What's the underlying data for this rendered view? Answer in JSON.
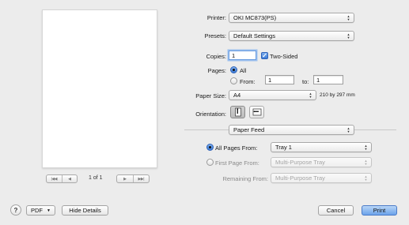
{
  "printer": {
    "label": "Printer:",
    "value": "OKI MC873(PS)"
  },
  "presets": {
    "label": "Presets:",
    "value": "Default Settings"
  },
  "copies": {
    "label": "Copies:",
    "value": "1",
    "two_sided_label": "Two-Sided",
    "two_sided_checked": true
  },
  "pages": {
    "label": "Pages:",
    "all_label": "All",
    "from_label": "From:",
    "from_value": "1",
    "to_label": "to:",
    "to_value": "1",
    "selected": "All"
  },
  "paper_size": {
    "label": "Paper Size:",
    "value": "A4",
    "dimensions": "210 by 297 mm"
  },
  "orientation": {
    "label": "Orientation:",
    "selected": "portrait"
  },
  "section_popup": {
    "value": "Paper Feed"
  },
  "paper_feed": {
    "all_pages_label": "All Pages From:",
    "all_pages_value": "Tray 1",
    "first_page_label": "First Page From:",
    "first_page_value": "Multi-Purpose Tray",
    "remaining_label": "Remaining From:",
    "remaining_value": "Multi-Purpose Tray",
    "selected": "all_pages"
  },
  "preview_nav": {
    "first": "|◀◀",
    "prev": "◀",
    "next": "▶",
    "last": "▶▶|",
    "page_count": "1 of 1"
  },
  "footer": {
    "help": "?",
    "pdf_label": "PDF",
    "hide_details": "Hide Details",
    "cancel": "Cancel",
    "print": "Print"
  },
  "colors": {
    "accent": "#3b7ad6",
    "background": "#ececec"
  },
  "icons": [
    "help-icon",
    "checkmark-icon",
    "portrait-orientation-icon",
    "landscape-orientation-icon",
    "popup-arrows-icon",
    "dropdown-arrow-icon"
  ]
}
